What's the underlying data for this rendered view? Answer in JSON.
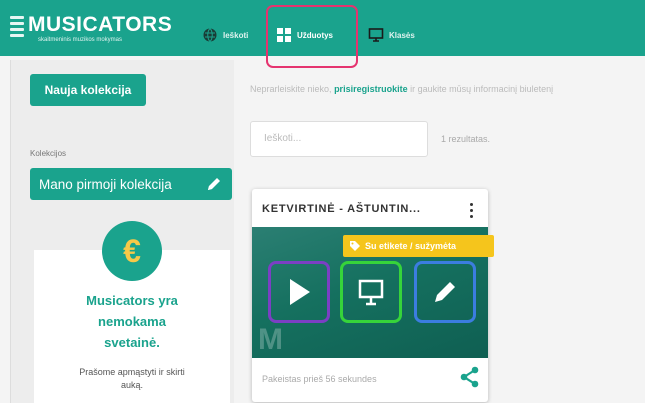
{
  "header": {
    "logo_title": "MUSICATORS",
    "logo_subtitle": "skaitmeninis muzikos mokymas",
    "nav": [
      {
        "label": "Ieškoti",
        "icon": "globe-icon"
      },
      {
        "label": "Užduotys",
        "icon": "tasks-icon"
      },
      {
        "label": "Klasės",
        "icon": "board-icon"
      }
    ]
  },
  "sidebar": {
    "new_collection_label": "Nauja kolekcija",
    "collections_label": "Kolekcijos",
    "collection_name": "Mano pirmoji kolekcija",
    "promo_icon": "€",
    "promo_title_1": "Musicators yra",
    "promo_title_2": "nemokama",
    "promo_title_3": "svetainė.",
    "promo_text_1": "Prašome apmąstyti ir skirti",
    "promo_text_2": "auką."
  },
  "main": {
    "notice_before": "Neprarleiskite nieko,",
    "notice_link": "prisiregistruokite",
    "notice_after": "ir gaukite mūsų informacinį biuletenį",
    "search_placeholder": "Ieškoti...",
    "results_text": "1 rezultatas.",
    "card": {
      "title": "KETVIRTINĖ - AŠTUNTIN...",
      "tag": "Su etikete / sužymėta",
      "watermark": "M",
      "footer": "Pakeistas prieš 56 sekundes"
    }
  },
  "colors": {
    "brand": "#1aa38d",
    "nav_highlight": "#e5336f",
    "tag": "#f5c51c",
    "play_outline": "#7b3fc4",
    "present_outline": "#36d43a",
    "edit_outline": "#3b7de0"
  }
}
